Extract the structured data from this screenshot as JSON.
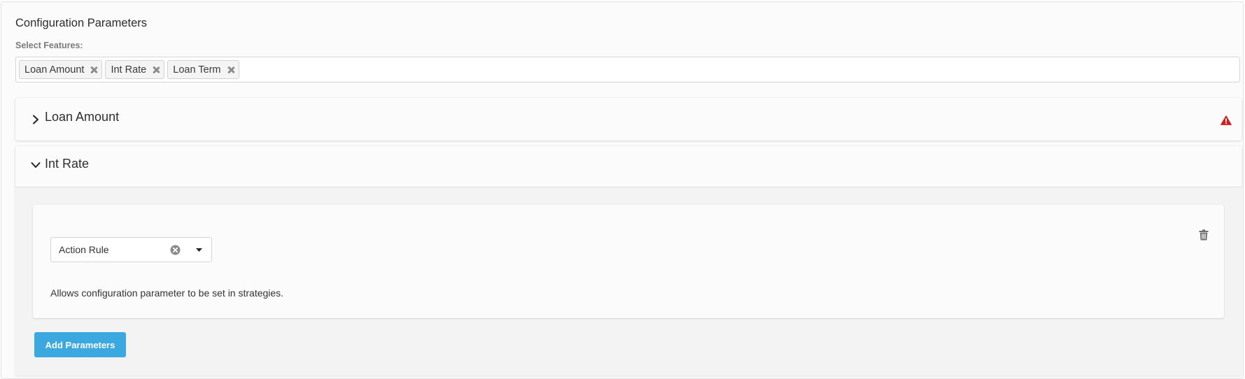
{
  "page": {
    "title": "Configuration Parameters"
  },
  "features": {
    "label": "Select Features:",
    "tags": [
      {
        "label": "Loan Amount",
        "remove_icon": "close-icon"
      },
      {
        "label": "Int Rate",
        "remove_icon": "close-icon"
      },
      {
        "label": "Loan Term",
        "remove_icon": "close-icon"
      }
    ]
  },
  "accordions": [
    {
      "title": "Loan Amount",
      "state": "collapsed",
      "icon": "chevron-right-icon",
      "status_icon": "warning-icon",
      "status_color": "#cc1f1f"
    },
    {
      "title": "Int Rate",
      "state": "expanded",
      "icon": "chevron-down-icon",
      "parameter": {
        "select_value": "Action Rule",
        "clear_icon": "clear-icon",
        "dropdown_icon": "caret-down-icon",
        "delete_icon": "trash-icon",
        "description": "Allows configuration parameter to be set in strategies."
      },
      "add_button_label": "Add Parameters"
    }
  ],
  "colors": {
    "accent": "#3ba9e0",
    "warning": "#cc1f1f",
    "panel_background": "#fbfbfb",
    "body_background": "#f3f3f3"
  }
}
